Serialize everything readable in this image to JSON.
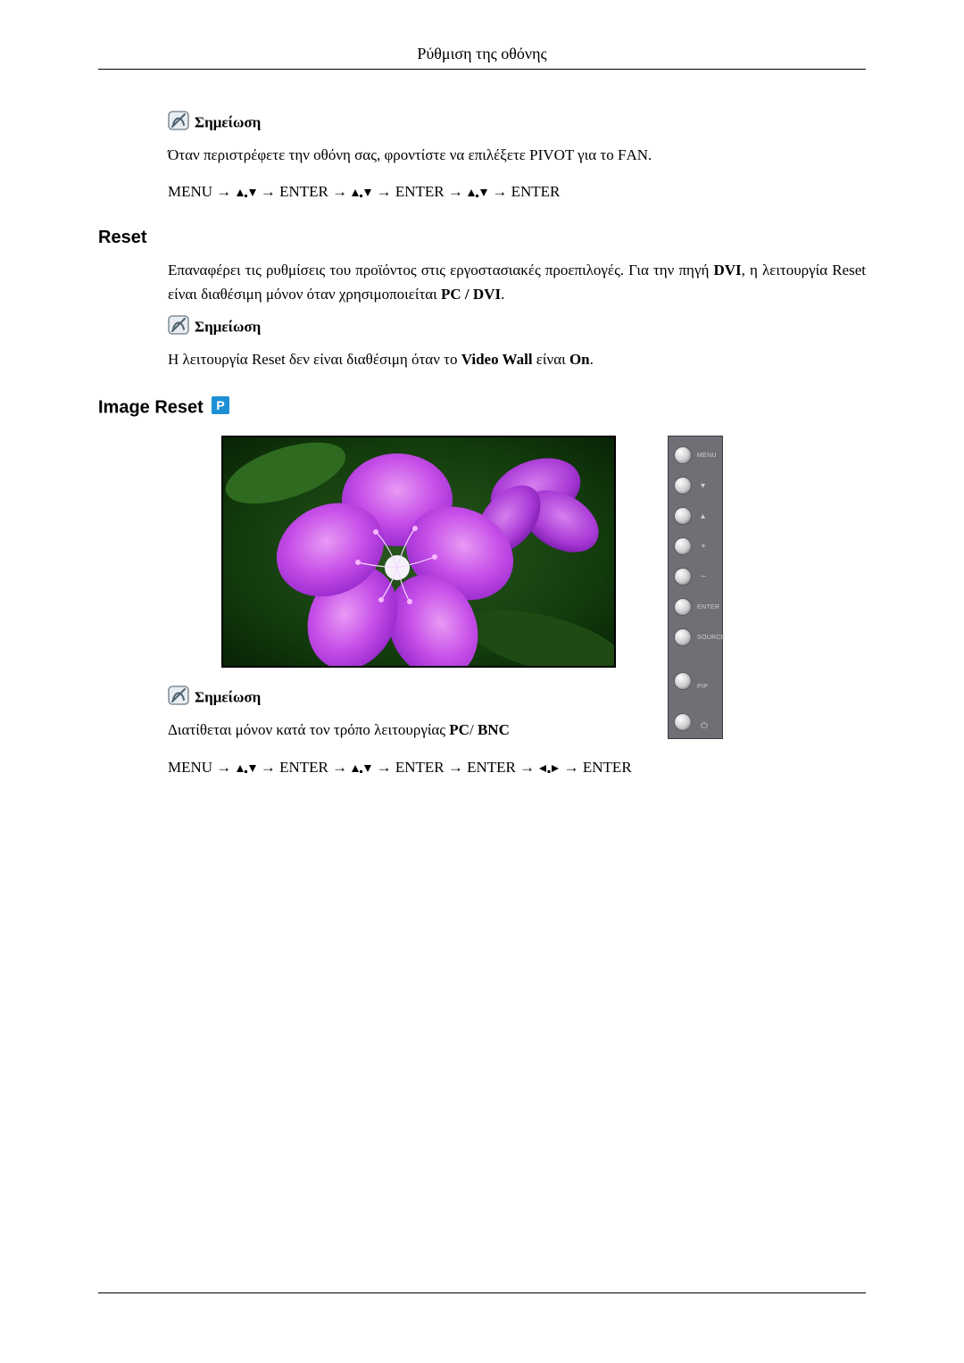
{
  "header": {
    "title": "Ρύθμιση της οθόνης"
  },
  "note_label": "Σημείωση",
  "block1": {
    "text": "Όταν περιστρέφετε την οθόνη σας, φροντίστε να επιλέξετε PIVOT για το FΑΝ.",
    "nav": {
      "p1": "MENU → ",
      "p2": " → ENTER → ",
      "p3": " → ENTER → ",
      "p4": " → ENTER"
    }
  },
  "reset": {
    "heading": "Reset",
    "text_a": "Επαναφέρει τις ρυθμίσεις του προϊόντος στις εργοστασιακές προεπιλογές. Για την πηγή ",
    "text_b_bold": "DVI",
    "text_c": ", η λειτουργία Reset είναι διαθέσιμη μόνον όταν χρησιμοποιείται ",
    "text_d_bold": "PC / DVI",
    "text_e": ".",
    "note_a": "Η λειτουργία Reset δεν είναι διαθέσιμη όταν το ",
    "note_b_bold": "Video Wall",
    "note_c": " είναι ",
    "note_d_bold": "On",
    "note_e": "."
  },
  "image_reset": {
    "heading": "Image Reset",
    "panel_buttons": [
      {
        "name": "menu-button",
        "label": "MENU",
        "kind": "text"
      },
      {
        "name": "down-button",
        "glyph": "▾",
        "kind": "glyph"
      },
      {
        "name": "up-button",
        "glyph": "▴",
        "kind": "glyph"
      },
      {
        "name": "plus-button",
        "glyph": "+",
        "kind": "glyph"
      },
      {
        "name": "minus-button",
        "glyph": "−",
        "kind": "glyph"
      },
      {
        "name": "enter-button",
        "label": "ENTER",
        "kind": "text"
      },
      {
        "name": "source-button",
        "label": "SOURCE",
        "kind": "text"
      },
      {
        "name": "pip-button",
        "label": "PIP",
        "kind": "text",
        "gap": true
      },
      {
        "name": "power-button",
        "glyph": "⏻",
        "kind": "glyph",
        "gap": true
      }
    ],
    "note_a": "Διατίθεται μόνον κατά τον τρόπο λειτουργίας ",
    "note_b_bold": "PC",
    "note_c": "/ ",
    "note_d_bold": "BNC",
    "nav": {
      "p1": "MENU → ",
      "p2": " → ENTER → ",
      "p3": " → ENTER → ENTER → ",
      "p4": "→ ENTER"
    }
  }
}
